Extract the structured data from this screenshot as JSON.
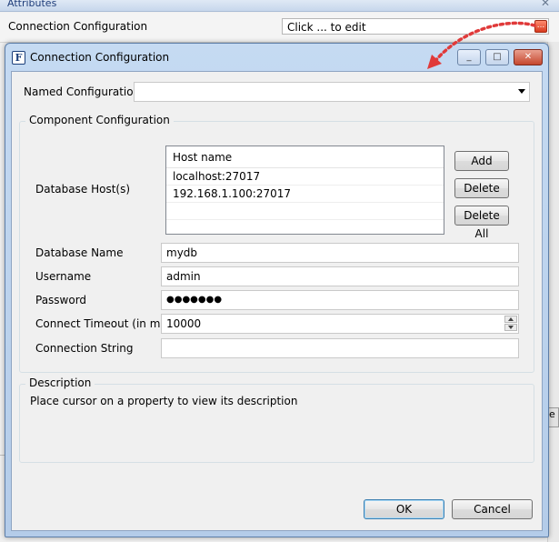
{
  "background": {
    "panel_title": "Attributes",
    "panel_close": "✕",
    "row_label": "Connection Configuration",
    "row_value": "Click ... to edit",
    "row_button": "...",
    "right_button_fragment": "e"
  },
  "dialog": {
    "icon_letter": "F",
    "title": "Connection Configuration",
    "minimize": "_",
    "maximize": "□",
    "close": "✕",
    "named_configuration": {
      "label": "Named Configuration",
      "value": ""
    },
    "component_group_title": "Component Configuration",
    "database_hosts": {
      "label": "Database Host(s)",
      "column_header": "Host name",
      "rows": [
        "localhost:27017",
        "192.168.1.100:27017"
      ]
    },
    "host_buttons": {
      "add": "Add",
      "delete": "Delete",
      "delete_all": "Delete All"
    },
    "fields": {
      "database_name": {
        "label": "Database Name",
        "value": "mydb"
      },
      "username": {
        "label": "Username",
        "value": "admin"
      },
      "password": {
        "label": "Password",
        "value": "●●●●●●●"
      },
      "connect_timeout": {
        "label": "Connect Timeout (in ms)",
        "value": "10000"
      },
      "connection_string": {
        "label": "Connection String",
        "value": ""
      }
    },
    "description": {
      "title": "Description",
      "text": "Place cursor on a property to view its description"
    },
    "ok": "OK",
    "cancel": "Cancel"
  },
  "colors": {
    "dialog_frame": "#b4cce9",
    "annotation_arrow": "#e03a3a",
    "close_button": "#c5472e"
  }
}
